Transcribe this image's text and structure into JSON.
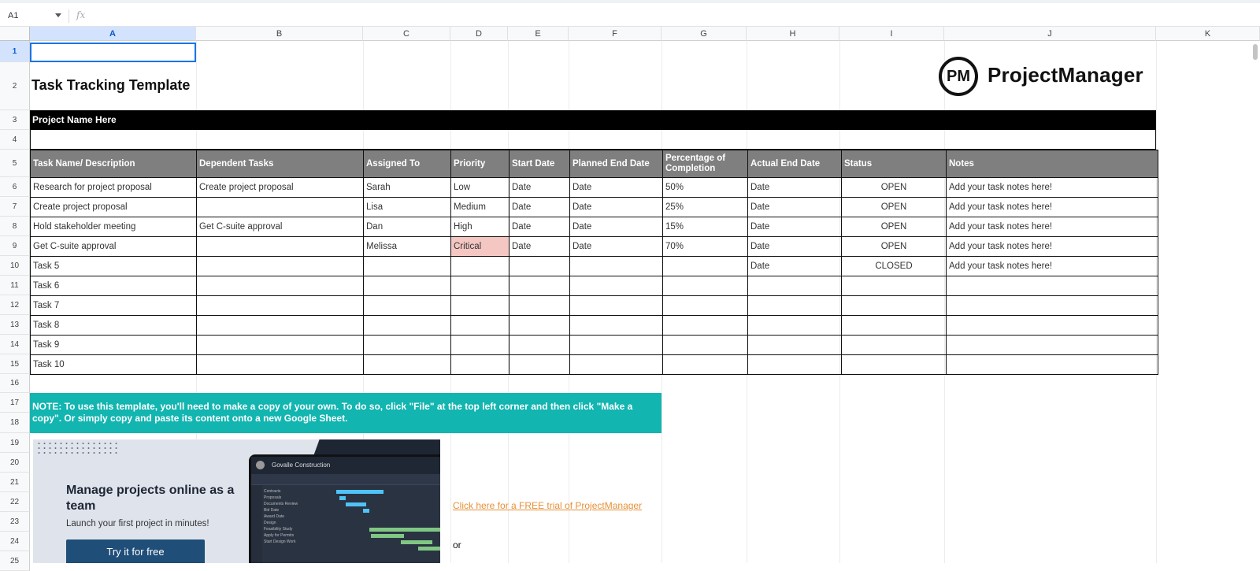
{
  "formula_bar": {
    "name_box": "A1",
    "fx": "fx"
  },
  "columns": [
    "A",
    "B",
    "C",
    "D",
    "E",
    "F",
    "G",
    "H",
    "I",
    "J",
    "K"
  ],
  "rows": [
    "1",
    "2",
    "3",
    "4",
    "5",
    "6",
    "7",
    "8",
    "9",
    "10",
    "11",
    "12",
    "13",
    "14",
    "15",
    "16",
    "17",
    "18",
    "19",
    "20",
    "21",
    "22",
    "23",
    "24",
    "25"
  ],
  "sheet": {
    "title": "Task Tracking Template",
    "brand": {
      "logo": "PM",
      "name": "ProjectManager"
    },
    "project_name": "Project Name Here",
    "headers": [
      "Task Name/ Description",
      "Dependent Tasks",
      "Assigned To",
      "Priority",
      "Start Date",
      "Planned End Date",
      "Percentage of Completion",
      "Actual End Date",
      "Status",
      "Notes"
    ],
    "tasks": [
      {
        "name": "Research for project proposal",
        "dep": "Create project proposal",
        "assigned": "Sarah",
        "priority": "Low",
        "start": "Date",
        "planned": "Date",
        "pct": "50%",
        "actual": "Date",
        "status": "OPEN",
        "notes": "Add your task notes here!"
      },
      {
        "name": "Create project proposal",
        "dep": "",
        "assigned": "Lisa",
        "priority": "Medium",
        "start": "Date",
        "planned": "Date",
        "pct": "25%",
        "actual": "Date",
        "status": "OPEN",
        "notes": "Add your task notes here!"
      },
      {
        "name": "Hold stakeholder meeting",
        "dep": "Get C-suite approval",
        "assigned": "Dan",
        "priority": "High",
        "start": "Date",
        "planned": "Date",
        "pct": "15%",
        "actual": "Date",
        "status": "OPEN",
        "notes": "Add your task notes here!"
      },
      {
        "name": "Get C-suite approval",
        "dep": "",
        "assigned": "Melissa",
        "priority": "Critical",
        "start": "Date",
        "planned": "Date",
        "pct": "70%",
        "actual": "Date",
        "status": "OPEN",
        "notes": "Add your task notes here!"
      },
      {
        "name": "Task 5",
        "dep": "",
        "assigned": "",
        "priority": "",
        "start": "",
        "planned": "",
        "pct": "",
        "actual": "Date",
        "status": "CLOSED",
        "notes": "Add your task notes here!"
      },
      {
        "name": "Task 6",
        "dep": "",
        "assigned": "",
        "priority": "",
        "start": "",
        "planned": "",
        "pct": "",
        "actual": "",
        "status": "",
        "notes": ""
      },
      {
        "name": "Task 7",
        "dep": "",
        "assigned": "",
        "priority": "",
        "start": "",
        "planned": "",
        "pct": "",
        "actual": "",
        "status": "",
        "notes": ""
      },
      {
        "name": "Task 8",
        "dep": "",
        "assigned": "",
        "priority": "",
        "start": "",
        "planned": "",
        "pct": "",
        "actual": "",
        "status": "",
        "notes": ""
      },
      {
        "name": "Task 9",
        "dep": "",
        "assigned": "",
        "priority": "",
        "start": "",
        "planned": "",
        "pct": "",
        "actual": "",
        "status": "",
        "notes": ""
      },
      {
        "name": "Task 10",
        "dep": "",
        "assigned": "",
        "priority": "",
        "start": "",
        "planned": "",
        "pct": "",
        "actual": "",
        "status": "",
        "notes": ""
      }
    ],
    "note": "NOTE: To use this template, you'll need to make a copy of your own. To do so, click \"File\" at the top left corner and then click \"Make a copy\". Or simply copy and paste its content onto a new Google Sheet.",
    "promo": {
      "heading": "Manage projects online as a team",
      "sub": "Launch your first project in minutes!",
      "button": "Try it for free",
      "app_title": "Govalle Construction",
      "app_rows": [
        "Contracts",
        "Proposals",
        "Documents Review",
        "Bid Date",
        "Award Date",
        "Design",
        "Feasibility Study",
        "Apply for Permits",
        "Start Design Work"
      ]
    },
    "trial_link": "Click here for a FREE trial of ProjectManager",
    "or_text": "or"
  },
  "colors": {
    "header_gray": "#7f7f7f",
    "note_teal": "#12b5b0",
    "link_orange": "#e69138",
    "selection_blue": "#1a73e8"
  }
}
